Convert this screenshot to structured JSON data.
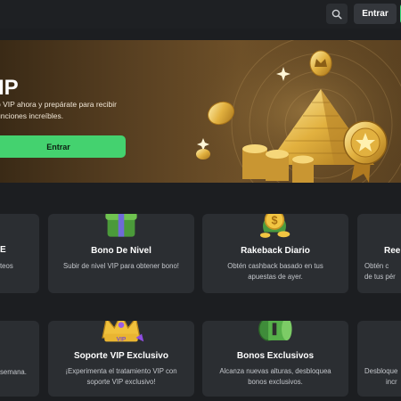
{
  "header": {
    "search_icon": "search-icon",
    "login_label": "Entrar"
  },
  "hero": {
    "title_partial": "IP",
    "subtitle_line1": "b VIP ahora y prepárate para recibir",
    "subtitle_line2": "unciones increíbles.",
    "cta_label": "Entrar"
  },
  "cards_row1": {
    "left_partial_title": "E",
    "left_partial_desc": "teos",
    "card1": {
      "icon": "gift-icon",
      "title": "Bono De Nivel",
      "desc": "Subir de nivel VIP para obtener bono!"
    },
    "card2": {
      "icon": "coin-bag-icon",
      "title": "Rakeback Diario",
      "desc_line1": "Obtén cashback basado en tus",
      "desc_line2": "apuestas de ayer."
    },
    "right_partial_title": "Ree",
    "right_partial_line1": "Obtén c",
    "right_partial_line2": "de tus pér"
  },
  "cards_row2": {
    "left_partial_desc": "semana.",
    "card1": {
      "icon": "crown-icon",
      "title": "Soporte VIP Exclusivo",
      "desc_line1": "¡Experimenta el tratamiento VIP con",
      "desc_line2": "soporte VIP exclusivo!"
    },
    "card2": {
      "icon": "money-roll-icon",
      "title": "Bonos Exclusivos",
      "desc_line1": "Alcanza nuevas alturas, desbloquea",
      "desc_line2": "bonos exclusivos."
    },
    "right_partial_line1": "Desbloque",
    "right_partial_line2": "incr"
  },
  "colors": {
    "background": "#1c1e21",
    "card": "#2b2e32",
    "accent_green": "#44d26f",
    "hero_gold": "#6e5028"
  }
}
